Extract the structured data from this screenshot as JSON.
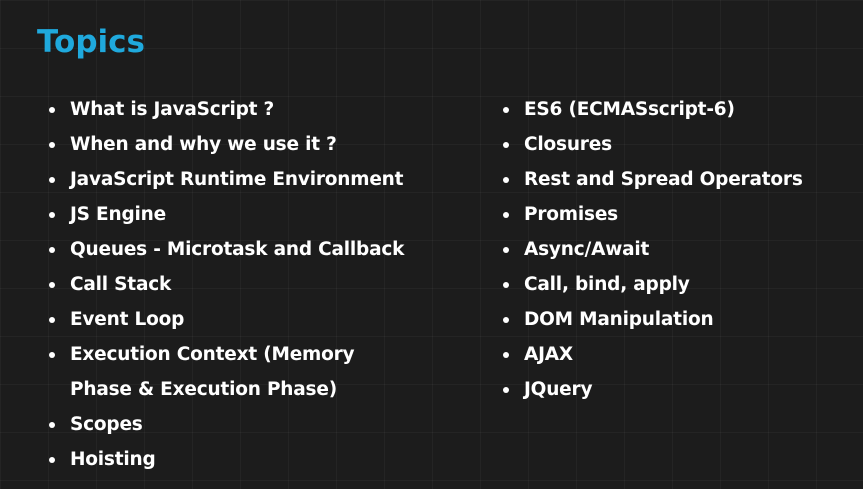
{
  "title": "Topics",
  "left_topics": [
    "What is JavaScript ?",
    "When and why we use it ?",
    "JavaScript Runtime Environment",
    "JS Engine",
    "Queues - Microtask and Callback",
    "Call Stack",
    "Event Loop",
    "Execution Context (Memory",
    "Phase & Execution Phase)",
    "Scopes",
    "Hoisting"
  ],
  "right_topics": [
    "ES6 (ECMASscript-6)",
    "Closures",
    "Rest and Spread Operators",
    "Promises",
    "Async/Await",
    "Call, bind, apply",
    "DOM Manipulation",
    "AJAX",
    "JQuery"
  ],
  "colors": {
    "title": "#1fa9dd",
    "text": "#ffffff",
    "background": "#1c1c1c"
  }
}
